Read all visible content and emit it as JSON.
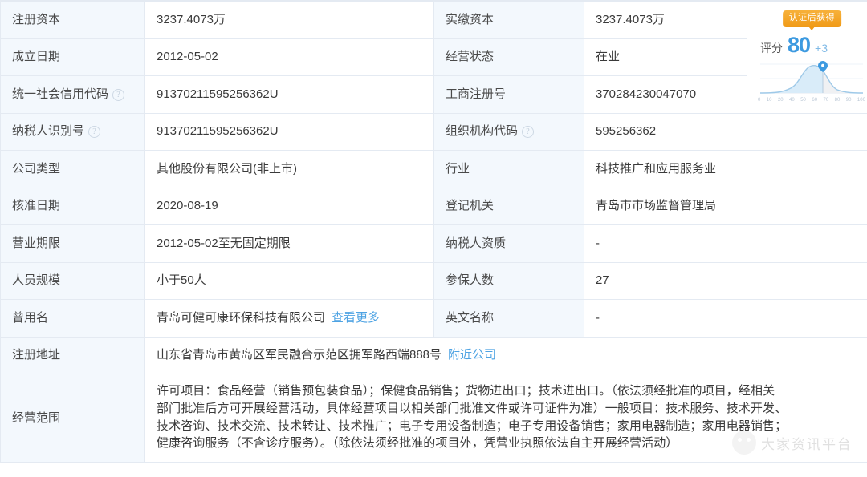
{
  "table": {
    "rows": [
      {
        "left_label": "注册资本",
        "left_help": false,
        "left_value": "3237.4073万",
        "right_label": "实缴资本",
        "right_help": false,
        "right_value": "3237.4073万"
      },
      {
        "left_label": "成立日期",
        "left_help": false,
        "left_value": "2012-05-02",
        "right_label": "经营状态",
        "right_help": false,
        "right_value": "在业"
      },
      {
        "left_label": "统一社会信用代码",
        "left_help": true,
        "left_value": "91370211595256362U",
        "right_label": "工商注册号",
        "right_help": false,
        "right_value": "370284230047070"
      },
      {
        "left_label": "纳税人识别号",
        "left_help": true,
        "left_value": "91370211595256362U",
        "right_label": "组织机构代码",
        "right_help": true,
        "right_value": "595256362"
      },
      {
        "left_label": "公司类型",
        "left_help": false,
        "left_value": "其他股份有限公司(非上市)",
        "right_label": "行业",
        "right_help": false,
        "right_value": "科技推广和应用服务业"
      },
      {
        "left_label": "核准日期",
        "left_help": false,
        "left_value": "2020-08-19",
        "right_label": "登记机关",
        "right_help": false,
        "right_value": "青岛市市场监督管理局"
      },
      {
        "left_label": "营业期限",
        "left_help": false,
        "left_value": "2012-05-02至无固定期限",
        "right_label": "纳税人资质",
        "right_help": false,
        "right_value": "-"
      },
      {
        "left_label": "人员规模",
        "left_help": false,
        "left_value": "小于50人",
        "right_label": "参保人数",
        "right_help": false,
        "right_value": "27"
      },
      {
        "left_label": "曾用名",
        "left_help": false,
        "left_value": "青岛可健可康环保科技有限公司",
        "left_link": "查看更多",
        "right_label": "英文名称",
        "right_help": false,
        "right_value": "-"
      }
    ],
    "address_row": {
      "label": "注册地址",
      "value": "山东省青岛市黄岛区军民融合示范区拥军路西端888号",
      "link": "附近公司"
    },
    "scope_row": {
      "label": "经营范围",
      "lines": [
        "许可项目：食品经营（销售预包装食品）；保健食品销售；货物进出口；技术进出口。（依法须经批准的项目，经相关",
        "部门批准后方可开展经营活动，具体经营项目以相关部门批准文件或许可证件为准）一般项目：技术服务、技术开发、",
        "技术咨询、技术交流、技术转让、技术推广；电子专用设备制造；电子专用设备销售；家用电器制造；家用电器销售；",
        "健康咨询服务（不含诊疗服务）。（除依法须经批准的项目外，凭营业执照依法自主开展经营活动）"
      ]
    }
  },
  "score_widget": {
    "badge_text": "认证后获得",
    "label": "评分",
    "value": "80",
    "delta": "+3",
    "axis_ticks": [
      "0",
      "10",
      "20",
      "40",
      "50",
      "60",
      "70",
      "80",
      "90",
      "100"
    ],
    "accent_color": "#3d9ae0",
    "badge_color": "#f5a623"
  },
  "watermark": {
    "text": "大家资讯平台"
  },
  "icons": {
    "help": "?"
  }
}
